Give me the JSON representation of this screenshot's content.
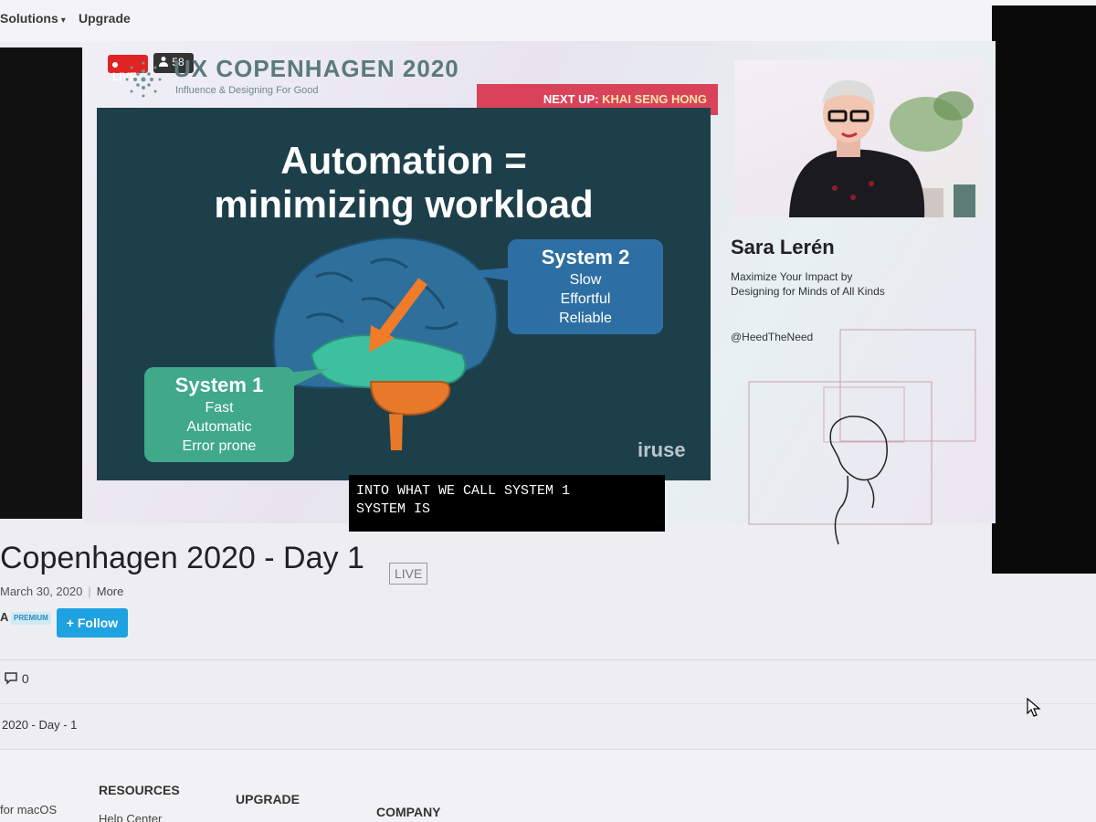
{
  "topnav": {
    "solutions_label": "Solutions",
    "upgrade_label": "Upgrade"
  },
  "stream": {
    "live_label": "LIVE",
    "viewer_count": "58",
    "conference_title": "UX COPENHAGEN 2020",
    "conference_subtitle": "Influence & Designing For Good",
    "next_up_prefix": "NEXT UP:",
    "next_up_name": "KHAI SENG HONG"
  },
  "slide": {
    "title_line1": "Automation =",
    "title_line2": "minimizing workload",
    "system1_title": "System 1",
    "system1_items": [
      "Fast",
      "Automatic",
      "Error prone"
    ],
    "system2_title": "System 2",
    "system2_items": [
      "Slow",
      "Effortful",
      "Reliable"
    ],
    "brand": "iruse"
  },
  "speaker": {
    "name": "Sara Lerén",
    "talk_title": "Maximize Your Impact by Designing for Minds of All Kinds",
    "handle": "@HeedTheNeed"
  },
  "caption": {
    "line1": "INTO WHAT WE CALL SYSTEM 1",
    "line2": "SYSTEM IS"
  },
  "event": {
    "title": "Copenhagen 2020 - Day 1",
    "live_tag": "LIVE",
    "date": "March 30, 2020",
    "more_label": "More",
    "channel_initial": "A",
    "premium_label": "PREMIUM",
    "follow_label": "+ Follow",
    "comment_count": "0",
    "breadcrumb": "2020 - Day - 1"
  },
  "footer": {
    "col_resources": "RESOURCES",
    "col_upgrade": "UPGRADE",
    "col_company": "COMPANY",
    "link_macos": "for macOS",
    "link_help": "Help Center"
  },
  "colors": {
    "live_red": "#e02424",
    "follow_blue": "#1ea2e0",
    "next_up_bg": "#d9435a",
    "slide_bg": "#1d3f4a"
  }
}
